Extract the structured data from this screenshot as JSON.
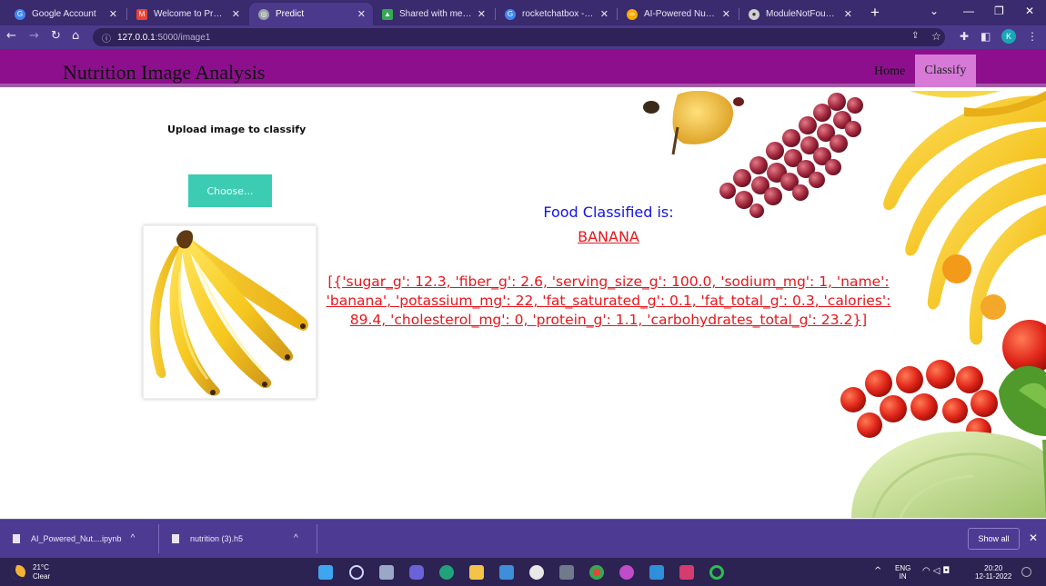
{
  "browser": {
    "tabs": [
      {
        "title": "Google Account",
        "icon": "google-icon",
        "color": "#4285f4"
      },
      {
        "title": "Welcome to Project!",
        "icon": "gmail-icon",
        "color": "#ea4335"
      },
      {
        "title": "Predict",
        "icon": "globe-icon",
        "color": "#9aa0a6",
        "active": true
      },
      {
        "title": "Shared with me - Goo",
        "icon": "drive-icon",
        "color": "#34a853"
      },
      {
        "title": "rocketchatbox - Goog",
        "icon": "google-icon",
        "color": "#4285f4"
      },
      {
        "title": "AI-Powered Nutrition",
        "icon": "colab-icon",
        "color": "#f9ab00"
      },
      {
        "title": "ModuleNotFoundErro",
        "icon": "github-icon",
        "color": "#cfcfcf"
      }
    ],
    "url_host": "127.0.0.1",
    "url_path": ":5000/image1",
    "profile_initial": "K"
  },
  "site": {
    "title": "Nutrition Image Analysis",
    "nav_home": "Home",
    "nav_classify": "Classify"
  },
  "upload": {
    "label": "Upload image to classify",
    "button": "Choose..."
  },
  "result": {
    "heading": "Food Classified is:",
    "class_name": "BANANA",
    "nutrition_text": "[{'sugar_g': 12.3, 'fiber_g': 2.6, 'serving_size_g': 100.0, 'sodium_mg': 1, 'name': 'banana', 'potassium_mg': 22, 'fat_saturated_g': 0.1, 'fat_total_g': 0.3, 'calories': 89.4, 'cholesterol_mg': 0, 'protein_g': 1.1, 'carbohydrates_total_g': 23.2}]"
  },
  "downloads": {
    "items": [
      "AI_Powered_Nut....ipynb",
      "nutrition (3).h5"
    ],
    "show_all": "Show all"
  },
  "taskbar": {
    "temperature": "21°C",
    "weather": "Clear",
    "lang_top": "ENG",
    "lang_bottom": "IN",
    "time": "20:20",
    "date": "12-11-2022"
  },
  "colors": {
    "header": "#8e0f8e",
    "nav_active": "#d77ad7",
    "button": "#3cccb3",
    "heading_blue": "#1212ee",
    "result_red": "#e8161b"
  }
}
